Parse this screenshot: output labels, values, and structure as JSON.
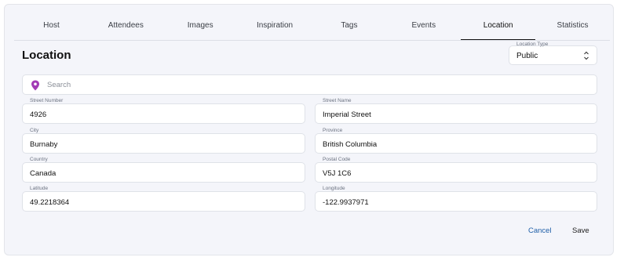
{
  "tabs": [
    "Host",
    "Attendees",
    "Images",
    "Inspiration",
    "Tags",
    "Events",
    "Location",
    "Statistics"
  ],
  "active_tab": "Location",
  "section_title": "Location",
  "location_type": {
    "label": "Location Type",
    "value": "Public"
  },
  "search": {
    "placeholder": "Search"
  },
  "fields": {
    "street_number": {
      "label": "Street Number",
      "value": "4926"
    },
    "street_name": {
      "label": "Street Name",
      "value": "Imperial Street"
    },
    "city": {
      "label": "City",
      "value": "Burnaby"
    },
    "province": {
      "label": "Province",
      "value": "British Columbia"
    },
    "country": {
      "label": "Country",
      "value": "Canada"
    },
    "postal_code": {
      "label": "Postal Code",
      "value": "V5J 1C6"
    },
    "latitude": {
      "label": "Latitude",
      "value": "49.2218364"
    },
    "longitude": {
      "label": "Longitude",
      "value": "-122.9937971"
    }
  },
  "actions": {
    "cancel": "Cancel",
    "save": "Save"
  },
  "colors": {
    "accent": "#1f5fa8",
    "pin": "#a23bb5",
    "card_bg": "#f4f5fa"
  },
  "icons": {
    "search": "map-pin-icon",
    "select": "chevron-up-down-icon"
  }
}
